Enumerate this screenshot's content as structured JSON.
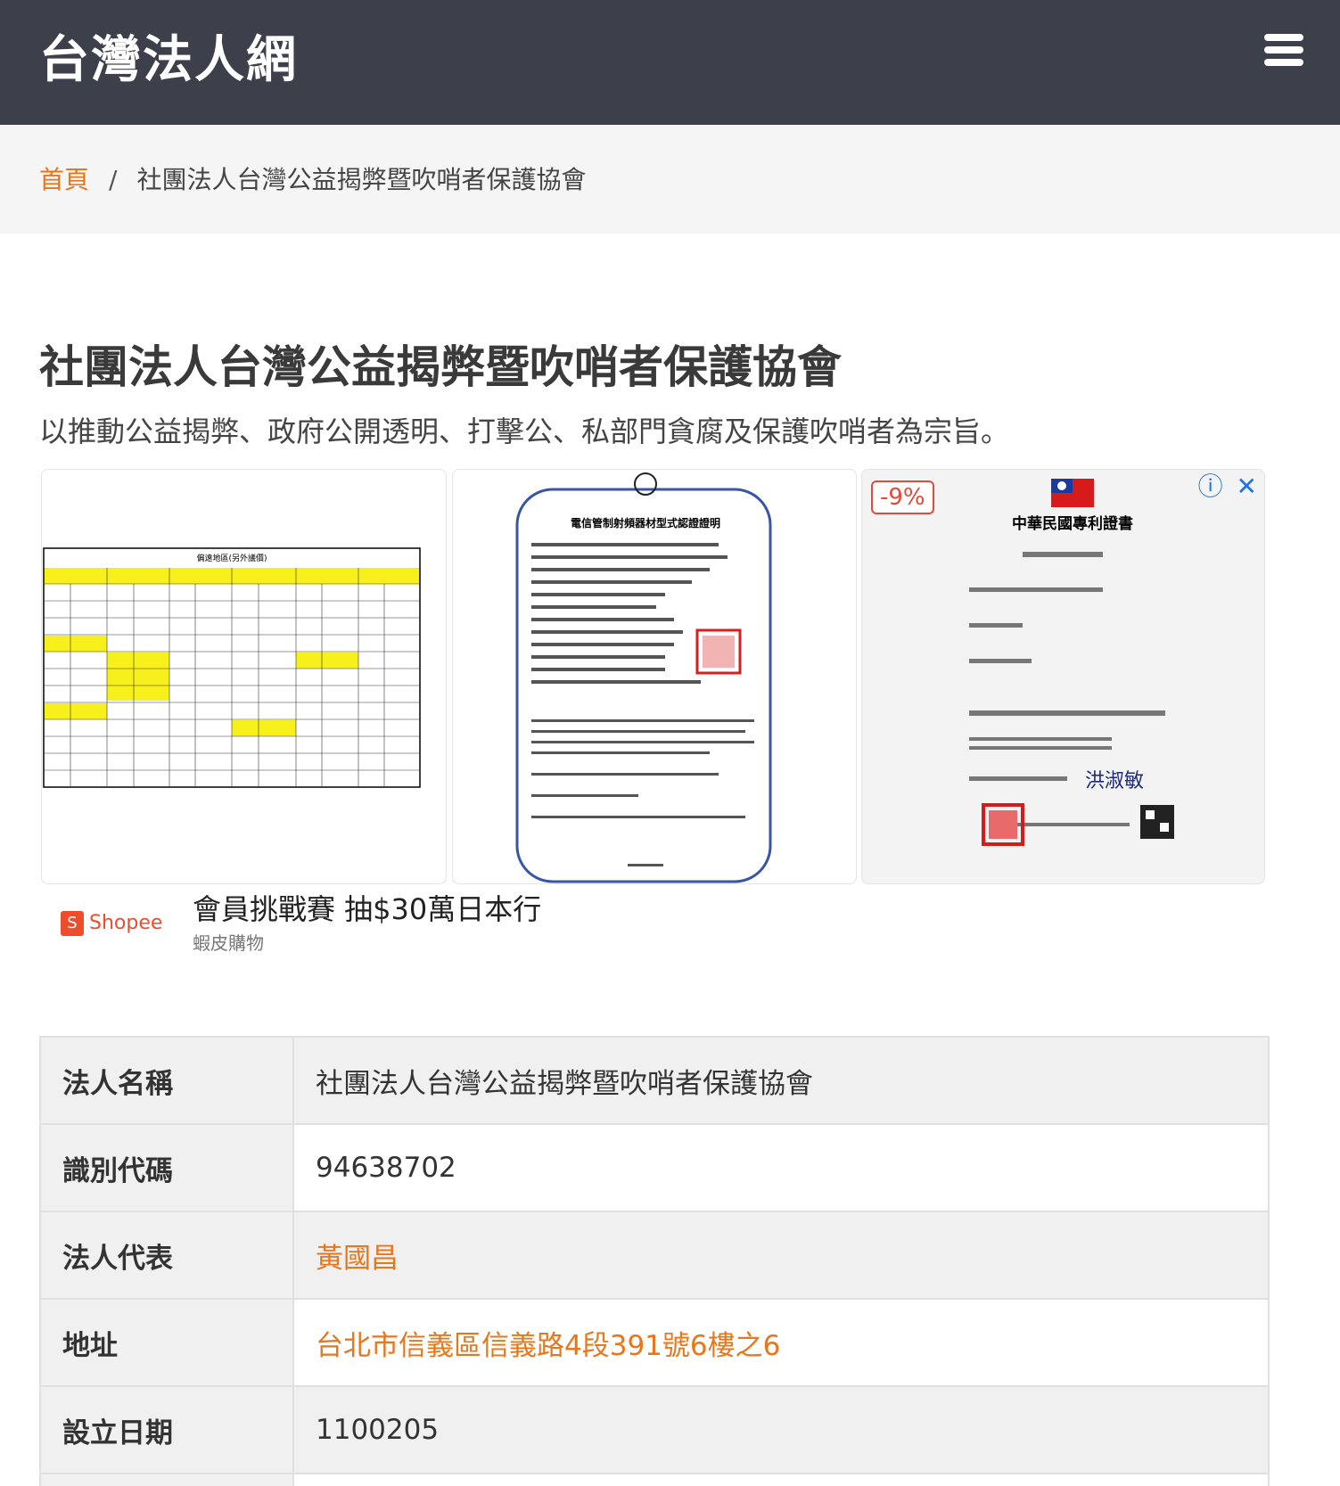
{
  "header": {
    "brand": "台灣法人網",
    "menu_icon": "hamburger-menu-icon"
  },
  "breadcrumb": {
    "home": "首頁",
    "separator": "/",
    "current": "社團法人台灣公益揭弊暨吹哨者保護協會"
  },
  "page": {
    "title": "社團法人台灣公益揭弊暨吹哨者保護協會",
    "description": "以推動公益揭弊、政府公開透明、打擊公、私部門貪腐及保護吹哨者為宗旨。"
  },
  "ad": {
    "discount": "-9%",
    "headline": "會員挑戰賽 抽$30萬日本行",
    "advertiser": "蝦皮購物",
    "logo_text": "Shopee",
    "info_icon": "ⓘ",
    "close_icon": "✕",
    "images": [
      {
        "title": "偏遠地區(另外議價)"
      },
      {
        "title": "電信管制射頻器材型式認證證明"
      },
      {
        "title": "中華民國專利證書"
      }
    ]
  },
  "info": [
    {
      "key": "法人名稱",
      "value": "社團法人台灣公益揭弊暨吹哨者保護協會",
      "link": false
    },
    {
      "key": "識別代碼",
      "value": "94638702",
      "link": false
    },
    {
      "key": "法人代表",
      "value": "黃國昌",
      "link": true
    },
    {
      "key": "地址",
      "value": "台北市信義區信義路4段391號6樓之6",
      "link": true
    },
    {
      "key": "設立日期",
      "value": "1100205",
      "link": false
    }
  ],
  "colors": {
    "header_bg": "#3d3f4b",
    "accent": "#e8761b",
    "breadcrumb_bg": "#f5f5f6"
  }
}
